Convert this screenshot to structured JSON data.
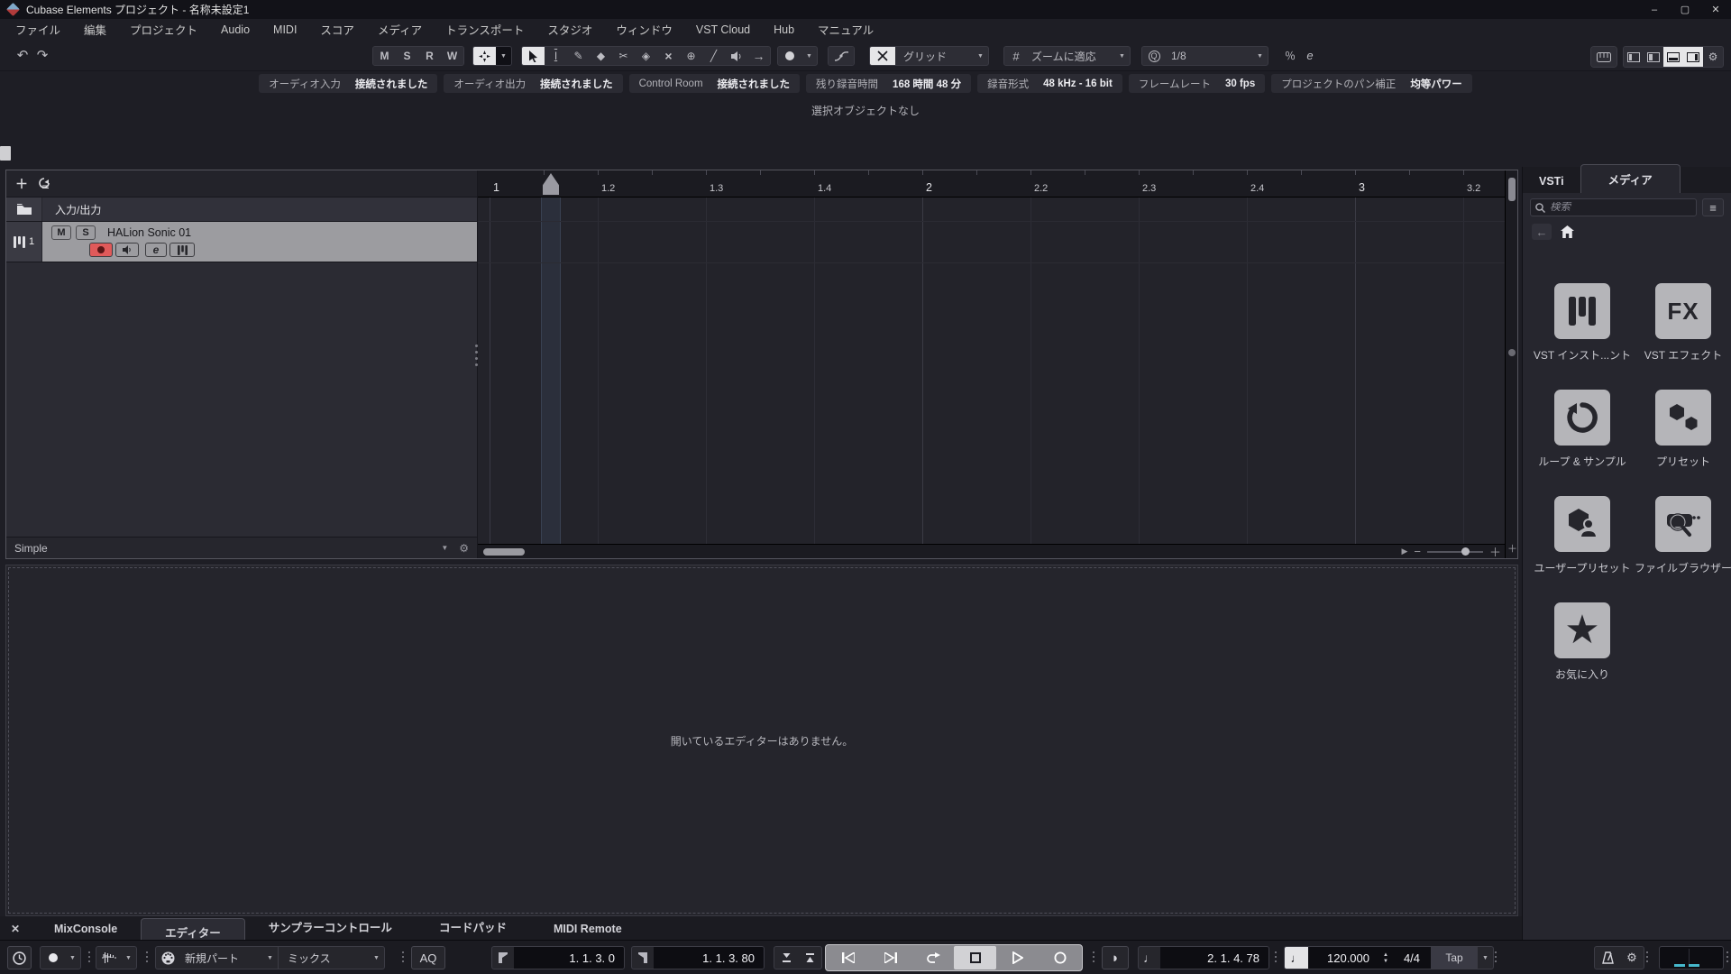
{
  "titlebar": {
    "title": "Cubase Elements プロジェクト - 名称未設定1",
    "minimize": "–",
    "maximize": "▢",
    "close": "✕"
  },
  "menubar": {
    "items": [
      "ファイル",
      "編集",
      "プロジェクト",
      "Audio",
      "MIDI",
      "スコア",
      "メディア",
      "トランスポート",
      "スタジオ",
      "ウィンドウ",
      "VST Cloud",
      "Hub",
      "マニュアル"
    ]
  },
  "toolbar": {
    "undo": "↶",
    "redo": "↷",
    "automation": [
      "M",
      "S",
      "R",
      "W"
    ],
    "tools": {
      "range": "I",
      "draw": "✎",
      "erase": "◆",
      "split": "✂",
      "glue": "◈",
      "mute": "×",
      "zoom": "⊕",
      "line": "╱",
      "feedback": "→"
    },
    "grid_label": "グリッド",
    "zoom_mode_label": "ズームに適応",
    "quantize_label": "1/8",
    "swing": "％",
    "length_q": "e"
  },
  "status_line": {
    "items": [
      {
        "label": "オーディオ入力",
        "value": "接続されました"
      },
      {
        "label": "オーディオ出力",
        "value": "接続されました"
      },
      {
        "label": "Control Room",
        "value": "接続されました"
      },
      {
        "label": "残り録音時間",
        "value": "168 時間 48 分"
      },
      {
        "label": "録音形式",
        "value": "48 kHz - 16 bit"
      },
      {
        "label": "フレームレート",
        "value": "30 fps"
      },
      {
        "label": "プロジェクトのパン補正",
        "value": "均等パワー"
      }
    ]
  },
  "info_line": {
    "text": "選択オブジェクトなし"
  },
  "project": {
    "io_label": "入力/出力",
    "track": {
      "number": "1",
      "name": "HALion Sonic 01",
      "mute": "M",
      "solo": "S",
      "edit": "e"
    },
    "preset_label": "Simple",
    "ruler_ticks": [
      "1",
      "1.2",
      "1.3",
      "1.4",
      "2",
      "2.2",
      "2.3",
      "2.4",
      "3",
      "3.2"
    ]
  },
  "lower_zone": {
    "message": "開いているエディターはありません。",
    "tabs": [
      "MixConsole",
      "エディター",
      "サンプラーコントロール",
      "コードパッド",
      "MIDI Remote"
    ],
    "close": "✕"
  },
  "right_zone": {
    "tabs": [
      "VSTi",
      "メディア"
    ],
    "search_placeholder": "検索",
    "tiles": [
      {
        "label": "VST インスト...ント"
      },
      {
        "label": "VST エフェクト",
        "icon_text": "FX"
      },
      {
        "label": "ループ & サンプル"
      },
      {
        "label": "プリセット"
      },
      {
        "label": "ユーザープリセット"
      },
      {
        "label": "ファイルブラウザー"
      },
      {
        "label": "お気に入り",
        "icon_text": "★"
      }
    ]
  },
  "transport": {
    "insert_mode": "新規パート",
    "record_mix_mode": "ミックス",
    "aq_label": "AQ",
    "left_locator": "1. 1. 3. 0",
    "right_locator": "1. 1. 3. 80",
    "position": "2. 1. 4. 78",
    "tempo": "120.000",
    "time_signature": "4/4",
    "tap_label": "Tap"
  },
  "colors": {
    "accent_cyan": "#46b8cc",
    "record_red": "#e05a5a",
    "selected_track": "#9c9ca0"
  }
}
